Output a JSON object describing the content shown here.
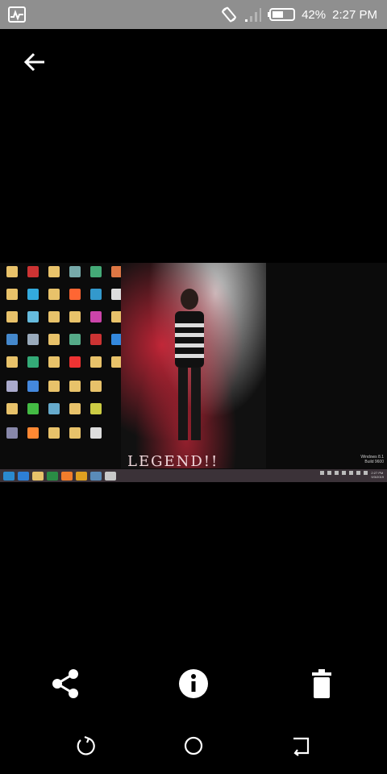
{
  "status_bar": {
    "battery_percent": "42%",
    "time": "2:27 PM",
    "icons": [
      "activity-icon",
      "rotate-icon",
      "signal-icon",
      "battery-icon"
    ]
  },
  "viewer": {
    "back_icon": "arrow-left-icon"
  },
  "photo": {
    "wallpaper_caption": "LEGEND!!",
    "os_watermark_line1": "Windows 8.1",
    "os_watermark_line2": "Build 9600",
    "taskbar_time": "2:27 PM",
    "taskbar_date": "9/3/2019"
  },
  "actions": {
    "share_icon": "share-icon",
    "info_icon": "info-icon",
    "delete_icon": "trash-icon"
  },
  "navigation": {
    "recents_icon": "recents-icon",
    "home_icon": "home-icon",
    "back_icon": "back-icon"
  }
}
